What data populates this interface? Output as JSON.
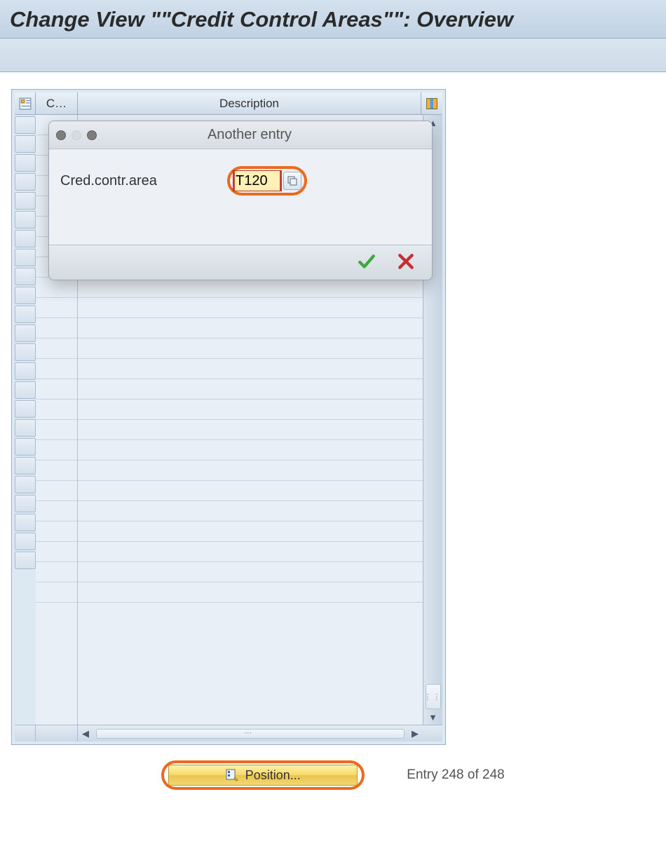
{
  "page": {
    "title": "Change View \"\"Credit Control Areas\"\": Overview"
  },
  "table": {
    "columns": {
      "code": "C…",
      "description": "Description"
    },
    "row_count_visible": 24
  },
  "dialog": {
    "title": "Another entry",
    "field_label": "Cred.contr.area",
    "field_value": "T120"
  },
  "footer": {
    "position_label": "Position...",
    "entry_label": "Entry 248 of 248",
    "entry_current": 248,
    "entry_total": 248
  }
}
